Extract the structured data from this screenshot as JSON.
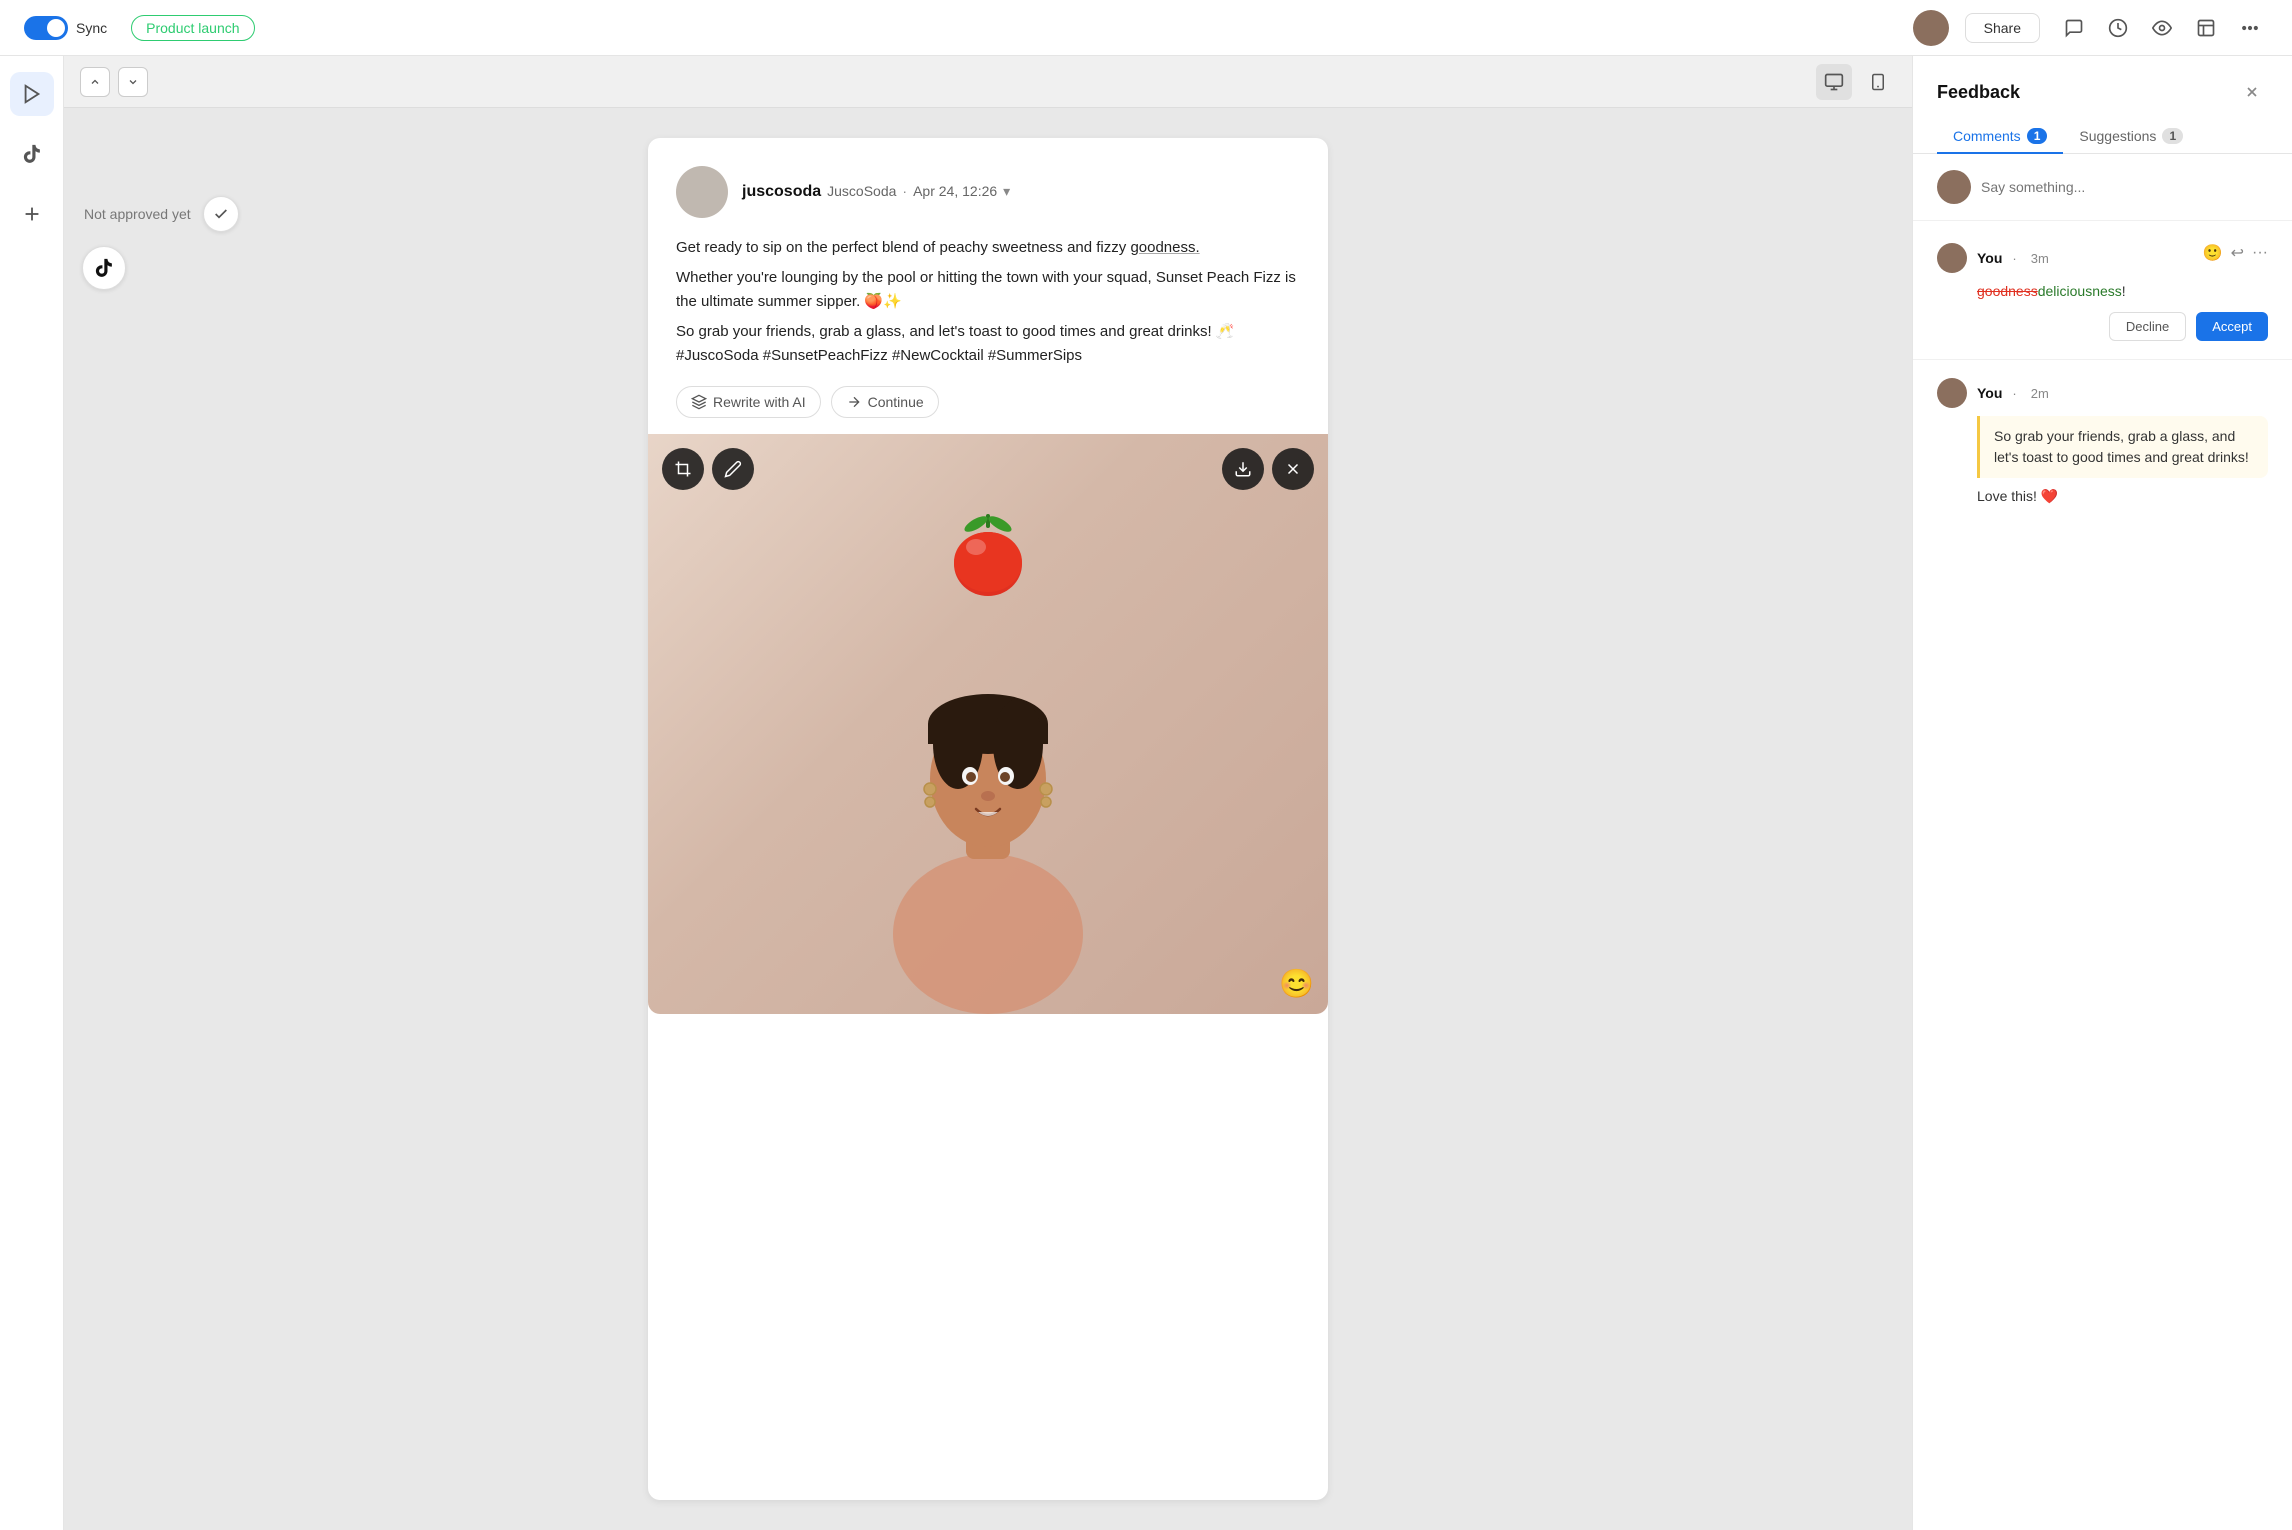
{
  "topbar": {
    "toggle_label": "Sync",
    "project_tag": "Product launch",
    "share_label": "Share",
    "icons": [
      "chat",
      "clock",
      "eye",
      "layout",
      "more"
    ]
  },
  "sidebar": {
    "items": [
      {
        "name": "video-icon",
        "symbol": "▶"
      },
      {
        "name": "tiktok-icon",
        "symbol": "♪"
      },
      {
        "name": "add-icon",
        "symbol": "+"
      }
    ]
  },
  "toolbar": {
    "nav_up": "▲",
    "nav_down": "▼",
    "view_desktop": "⬜",
    "view_mobile": "📱"
  },
  "approval": {
    "not_approved_text": "Not approved yet",
    "check_icon": "✓"
  },
  "post": {
    "avatar_initials": "",
    "username": "juscosoda",
    "handle": "JuscoSoda",
    "date": "Apr 24, 12:26",
    "content_line1": "Get ready to sip on the perfect blend of peachy sweetness and fizzy goodness.",
    "content_line2": "Whether you're lounging by the pool or hitting the town with your squad, Sunset Peach Fizz is the ultimate summer sipper. 🍑✨",
    "content_line3": "So grab your friends, grab a glass, and let's toast to good times and great drinks! 🥂 #JuscoSoda #SunsetPeachFizz #NewCocktail #SummerSips",
    "rewrite_label": "Rewrite with AI",
    "continue_label": "Continue",
    "emoji": "😊"
  },
  "feedback": {
    "title": "Feedback",
    "close_icon": "✕",
    "tab_comments": "Comments",
    "tab_comments_count": "1",
    "tab_suggestions": "Suggestions",
    "tab_suggestions_count": "1",
    "say_something_placeholder": "Say something...",
    "comment1": {
      "user": "You",
      "time": "3m",
      "strikethrough": "goodness",
      "inserted": "deliciousness",
      "punctuation": "!",
      "decline_label": "Decline",
      "accept_label": "Accept"
    },
    "comment2": {
      "user": "You",
      "time": "2m",
      "quote": "So grab your friends, grab a glass, and let's toast to good times and great drinks!",
      "text": "Love this! ❤️"
    }
  }
}
